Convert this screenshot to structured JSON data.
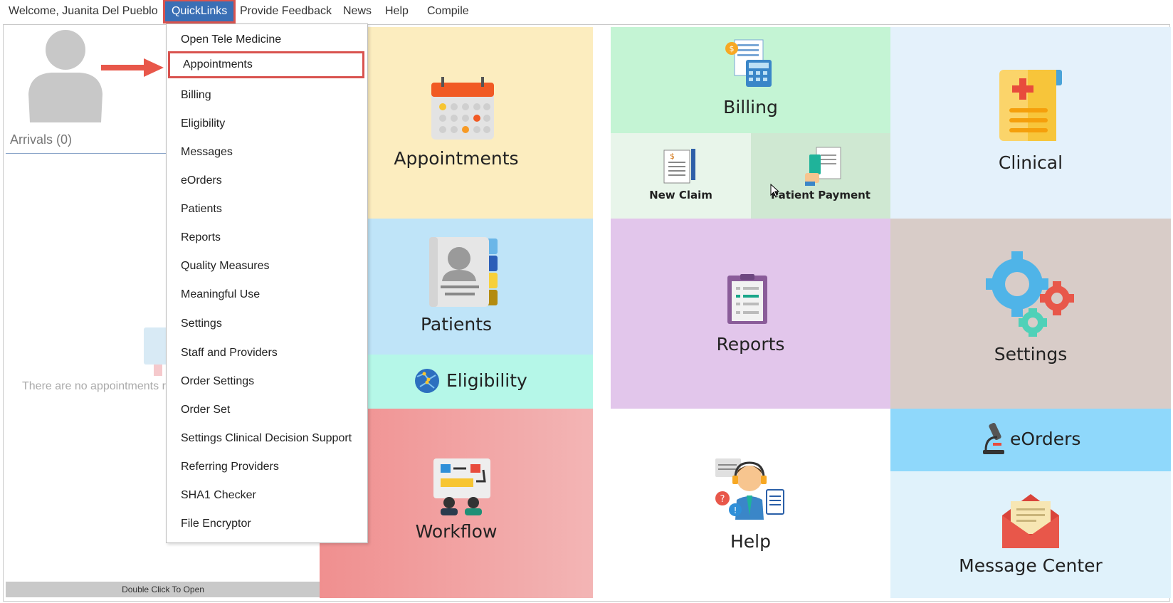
{
  "topnav": {
    "welcome": "Welcome, Juanita Del Pueblo",
    "quicklinks": "QuickLinks",
    "feedback": "Provide Feedback",
    "news": "News",
    "help": "Help",
    "compile": "Compile"
  },
  "left": {
    "arrivals": "Arrivals (0)",
    "empty": "There are no appointments r",
    "double_click": "Double Click To Open"
  },
  "menu": {
    "items": [
      "Open Tele Medicine",
      "Appointments",
      "Billing",
      "Eligibility",
      "Messages",
      "eOrders",
      "Patients",
      "Reports",
      "Quality Measures",
      "Meaningful Use",
      "Settings",
      "Staff and Providers",
      "Order Settings",
      "Order Set",
      "Settings Clinical Decision Support",
      "Referring Providers",
      "SHA1 Checker",
      "File Encryptor"
    ],
    "highlighted": "Appointments"
  },
  "tiles": {
    "appointments": "Appointments",
    "billing": "Billing",
    "new_claim": "New Claim",
    "patient_payment": "Patient Payment",
    "clinical": "Clinical",
    "patients": "Patients",
    "eligibility": "Eligibility",
    "reports": "Reports",
    "settings": "Settings",
    "workflow": "Workflow",
    "help": "Help",
    "eorders": "eOrders",
    "message_center": "Message Center"
  },
  "colors": {
    "appointments_bg": "#fcedbf",
    "billing_bg": "#c4f4d4",
    "new_claim_bg": "#e8f5ea",
    "patient_payment_bg": "#cfe8d2",
    "clinical_bg": "#e4f1fb",
    "patients_bg": "#bfe4f8",
    "eligibility_bg": "#b5f7e8",
    "reports_bg": "#e2c6eb",
    "settings_bg": "#d8ccc8",
    "workflow_bg": "#f0a3a3",
    "help_bg": "#ffffff",
    "eorders_bg": "#8fd8fb",
    "message_center_bg": "#e0f2fb",
    "accent_blue": "#3a6fb5",
    "highlight_red": "#d9534f"
  }
}
